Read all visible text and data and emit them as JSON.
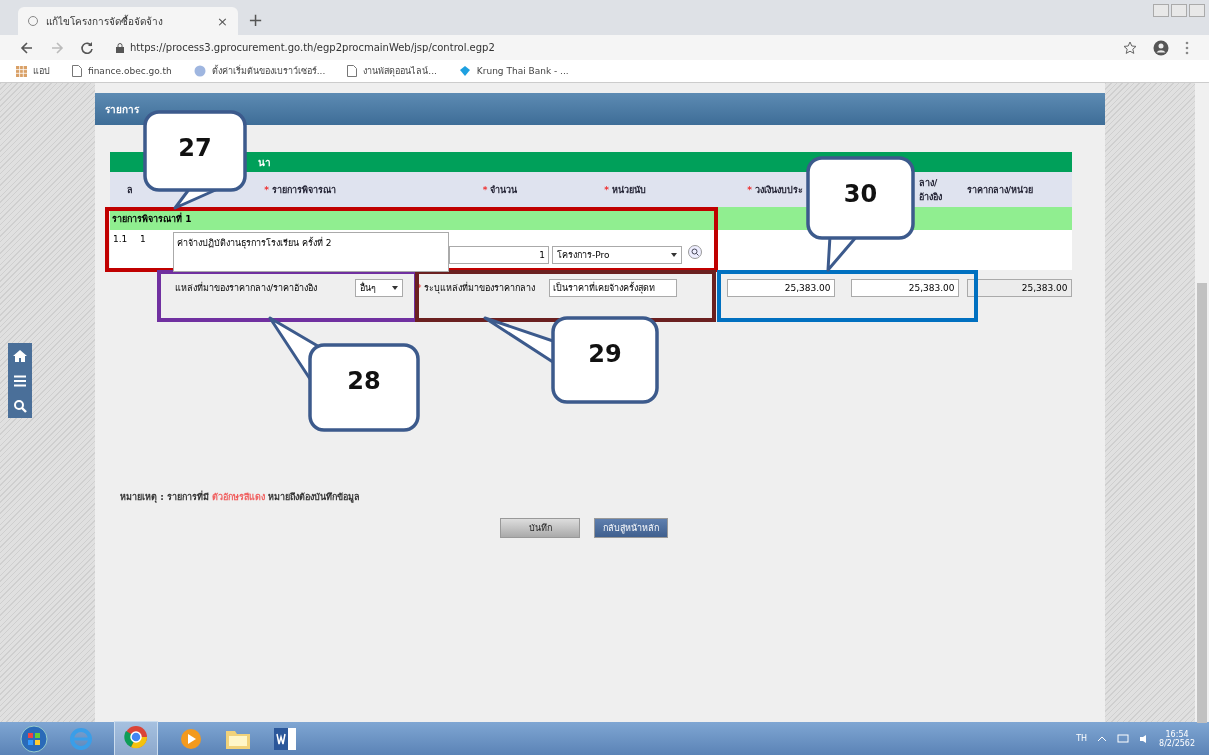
{
  "browser": {
    "tab_title": "แก้ไขโครงการจัดซื้อจัดจ้าง",
    "tab_close": "×",
    "new_tab": "+",
    "address": "https://process3.gprocurement.go.th/egp2procmainWeb/jsp/control.egp2",
    "bookmarks": [
      {
        "label": "แอป",
        "kind": "apps"
      },
      {
        "label": "finance.obec.go.th",
        "kind": "page"
      },
      {
        "label": "ตั้งค่าเริ่มต้นของเบราว์เซอร์...",
        "kind": "globe"
      },
      {
        "label": "งานพัสดุออนไลน์...",
        "kind": "page"
      },
      {
        "label": "Krung Thai Bank - ...",
        "kind": "bank"
      }
    ]
  },
  "panel": {
    "title": "รายการ",
    "section_title": "นา",
    "columns": [
      {
        "label": "ล"
      },
      {
        "mark": "*",
        "label": "รายการพิจารณา"
      },
      {
        "mark": "*",
        "label": "จำนวน"
      },
      {
        "mark": "*",
        "label": "หน่วยนับ"
      },
      {
        "mark": "*",
        "label": "วงเงินงบประ"
      },
      {
        "label": "ลาง/ อ้างอิง"
      },
      {
        "label": "ราคากลาง/หน่วย"
      }
    ],
    "item": {
      "group": "รายการพิจารณาที่ 1",
      "index": "1.1",
      "seq": "1",
      "description": "ค่าจ้างปฏิบัติงานธุรการโรงเรียน ครั้งที่ 2",
      "quantity": "1",
      "unit": "โครงการ-Pro",
      "source_label": "แหล่งที่มาของราคากลาง/ราคาอ้างอิง",
      "source": "อื่นๆ",
      "source_detail_mark": "*",
      "source_detail_label": "ระบุแหล่งที่มาของราคากลาง",
      "source_detail": "เป็นราคาที่เคยจ้างครั้งสุดท",
      "budget": "25,383.00",
      "reference_price": "25,383.00",
      "unit_price": "25,383.00"
    },
    "note": {
      "before": "หมายเหตุ : รายการที่มี",
      "highlight": "ตัวอักษรสีแดง",
      "after": "หมายถึงต้องบันทึกข้อมูล"
    },
    "buttons": [
      {
        "label": "บันทึก",
        "kind": "save"
      },
      {
        "label": "กลับสู่หน้าหลัก",
        "kind": "back"
      }
    ]
  },
  "highlights": [
    {
      "color": "#c00000"
    },
    {
      "color": "#7030a0"
    },
    {
      "color": "#6b2020"
    },
    {
      "color": "#0070c0"
    }
  ],
  "callouts": [
    "27",
    "28",
    "29",
    "30"
  ],
  "taskbar": {
    "language": "TH",
    "time": "16:54",
    "date": "8/2/2562"
  }
}
